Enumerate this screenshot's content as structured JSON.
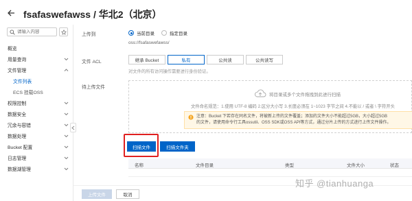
{
  "header": {
    "title": "fsafaswefawss / 华北2（北京）"
  },
  "sidebar": {
    "search_placeholder": "请输入内容",
    "items": [
      {
        "label": "概览",
        "has_chevron": false
      },
      {
        "label": "用量查询",
        "has_chevron": true
      },
      {
        "label": "文件管理",
        "has_chevron": true
      },
      {
        "label": "文件列表",
        "sub": true,
        "active": true
      },
      {
        "label": "ECS 挂载OSS",
        "sub": true
      },
      {
        "label": "权限控制",
        "has_chevron": true
      },
      {
        "label": "数据安全",
        "has_chevron": true
      },
      {
        "label": "冗余与容错",
        "has_chevron": true
      },
      {
        "label": "数据处理",
        "has_chevron": true
      },
      {
        "label": "Bucket 配置",
        "has_chevron": true
      },
      {
        "label": "日志管理",
        "has_chevron": true
      },
      {
        "label": "数据湖管理",
        "has_chevron": true
      }
    ]
  },
  "form": {
    "upload_to_label": "上传到",
    "radio_current": "当前目录",
    "radio_specified": "指定目录",
    "path": "oss://fsafaswefawss/",
    "acl_label": "文件 ACL",
    "acl_options": [
      "继承 Bucket",
      "私有",
      "公共读",
      "公共读写"
    ],
    "acl_selected": "私有",
    "acl_hint": "对文件的所有访问操作需要进行身份验证。",
    "pending_label": "待上传文件"
  },
  "dropzone": {
    "drop_text": "将目录或多个文件拖拽到此进行扫描",
    "rule_text": "文件命名规范：1.使用 UTF-8 编码 2.区分大小写 3.长度必须在 1~1023 字节之间 4.不能以 / 或者 \\ 字符开头",
    "notice_line1": "注意：Bucket 下若存在同名文件，将被新上传的文件覆盖；添加的文件大小不能超过5GB，大小超过5GB",
    "notice_line2": "的文件，请使用命令行工具ossutil、OSS SDK或OSS API等方式，通过分片上传的方式进行上传文件操作。"
  },
  "buttons": {
    "scan_files": "扫描文件",
    "scan_folder": "扫描文件夹",
    "upload": "上传文件",
    "cancel": "取消"
  },
  "table": {
    "columns": [
      "名称",
      "文件目录",
      "类型",
      "文件大小",
      "状态"
    ]
  },
  "watermark": "知乎 @tianhuanga",
  "colors": {
    "primary": "#0064c8",
    "highlight": "#e02020",
    "notice_bg": "#fff7e6"
  }
}
